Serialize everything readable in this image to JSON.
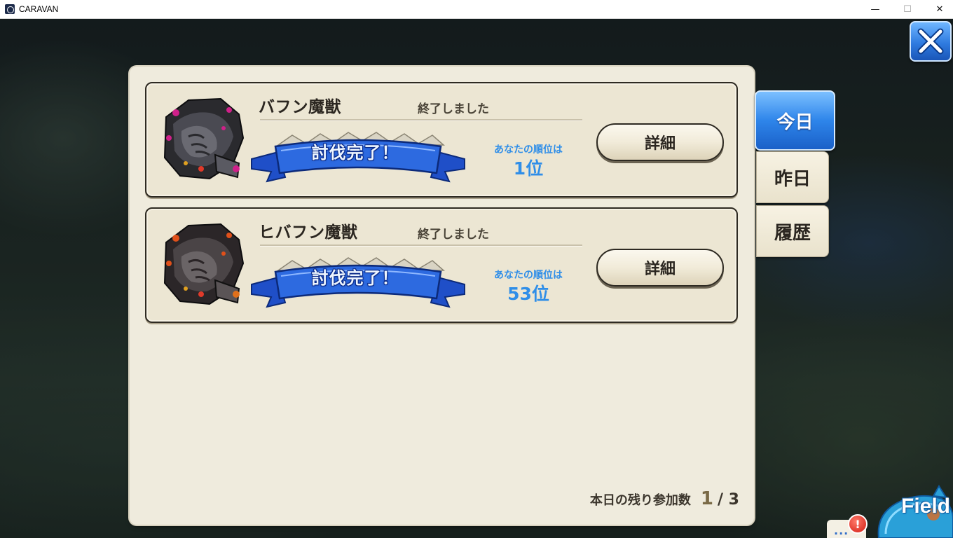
{
  "window": {
    "title": "CARAVAN",
    "minimize_glyph": "—",
    "maximize_glyph": "☐",
    "close_glyph": "✕"
  },
  "raid_list": [
    {
      "monster_name": "バフン魔獣",
      "status": "終了しました",
      "banner": "討伐完了！",
      "rank_label": "あなたの順位は",
      "rank_value": "1位",
      "detail_button": "詳細",
      "accent_color": "#d0208a"
    },
    {
      "monster_name": "ヒバフン魔獣",
      "status": "終了しました",
      "banner": "討伐完了！",
      "rank_label": "あなたの順位は",
      "rank_value": "53位",
      "detail_button": "詳細",
      "accent_color": "#e0501a"
    }
  ],
  "remaining": {
    "label": "本日の残り参加数",
    "current": "1",
    "total": "/ 3"
  },
  "tabs": {
    "today": "今日",
    "yesterday": "昨日",
    "history": "履歴"
  },
  "field": {
    "label": "Field",
    "chat_dots": "...",
    "alert": "!"
  },
  "colors": {
    "panel": "#efebdd",
    "tab_active": "#2e85ea",
    "rank_text": "#2f8ee8",
    "banner": "#1f4fc8"
  },
  "icons": {
    "close": "close-x-icon",
    "app": "caravan-app-icon"
  }
}
